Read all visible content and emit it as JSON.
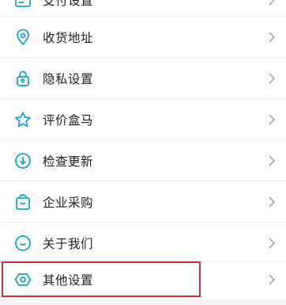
{
  "accent_color": "#14a3d2",
  "highlight_color": "#c8343b",
  "menu": {
    "items": [
      {
        "label": "支付设置",
        "icon": "wallet-icon"
      },
      {
        "label": "收货地址",
        "icon": "location-pin-icon"
      },
      {
        "label": "隐私设置",
        "icon": "lock-icon"
      },
      {
        "label": "评价盒马",
        "icon": "star-icon"
      },
      {
        "label": "检查更新",
        "icon": "download-circle-icon"
      },
      {
        "label": "企业采购",
        "icon": "shopping-bag-icon"
      },
      {
        "label": "关于我们",
        "icon": "smile-circle-icon"
      },
      {
        "label": "其他设置",
        "icon": "hexagon-settings-icon"
      }
    ]
  }
}
